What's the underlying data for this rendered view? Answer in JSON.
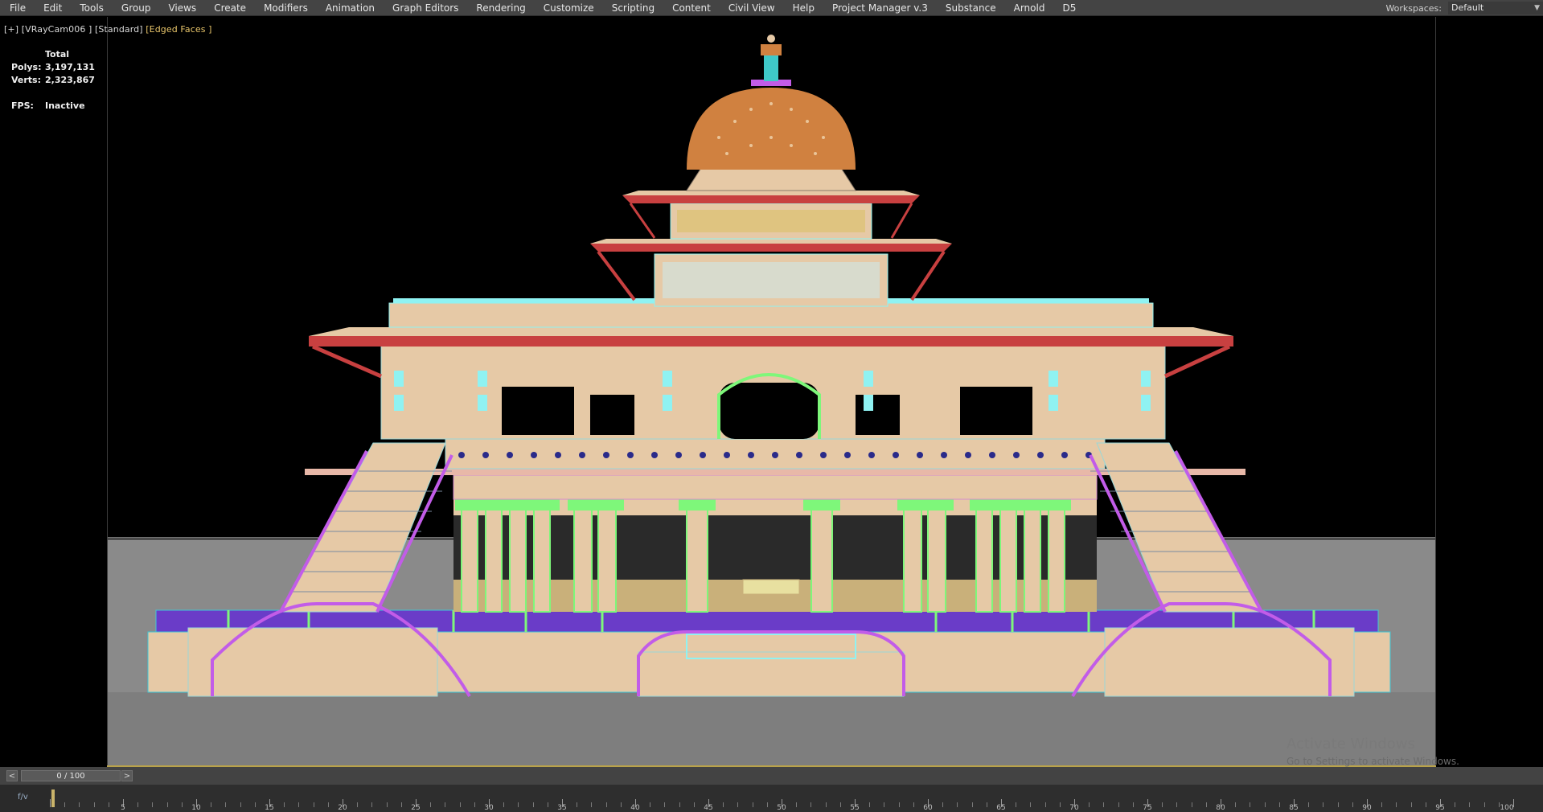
{
  "menubar": {
    "items": [
      "File",
      "Edit",
      "Tools",
      "Group",
      "Views",
      "Create",
      "Modifiers",
      "Animation",
      "Graph Editors",
      "Rendering",
      "Customize",
      "Scripting",
      "Content",
      "Civil View",
      "Help",
      "Project Manager v.3",
      "Substance",
      "Arnold",
      "D5"
    ],
    "workspaces_label": "Workspaces:",
    "workspaces_value": "Default"
  },
  "viewport": {
    "label_plus": "[+]",
    "label_camera": "[VRayCam006 ]",
    "label_shading": "[Standard]",
    "label_mode": "[Edged Faces ]",
    "stats": {
      "header": "Total",
      "polys_label": "Polys:",
      "polys_value": "3,197,131",
      "verts_label": "Verts:",
      "verts_value": "2,323,867",
      "fps_label": "FPS:",
      "fps_value": "Inactive"
    }
  },
  "watermark": {
    "title": "Activate Windows",
    "subtitle": "Go to Settings to activate Windows."
  },
  "timeline": {
    "prev": "<",
    "next": ">",
    "counter": "0 / 100",
    "tick_labels": [
      "5",
      "10",
      "15",
      "20",
      "25",
      "30",
      "35",
      "40",
      "45",
      "50",
      "55",
      "60",
      "65",
      "70",
      "75",
      "80",
      "85",
      "90",
      "95",
      "100"
    ],
    "current_frame": 0,
    "total_frames": 100
  },
  "colors": {
    "beige": "#e6c9a6",
    "cyan": "#8ff2f2",
    "green": "#7ef77a",
    "magenta": "#c25ce8",
    "red": "#c84040",
    "orange": "#d08140",
    "purple": "#6a3cc8",
    "navy": "#2a2a8a"
  }
}
